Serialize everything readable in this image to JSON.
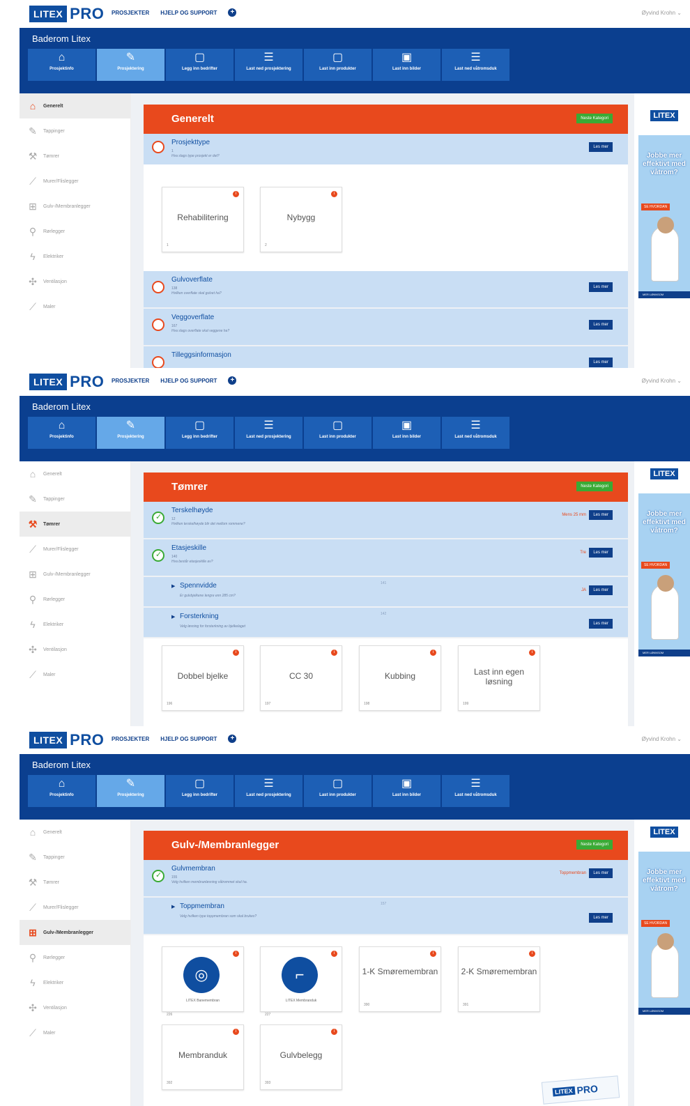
{
  "header": {
    "logo_text": "LITEX",
    "logo_pro": "PRO",
    "nav": [
      "PROSJEKTER",
      "HJELP OG SUPPORT"
    ],
    "user": "Øyvind Krohn ⌄",
    "project_title": "Baderom Litex"
  },
  "steps": [
    {
      "label": "Prosjektinfo",
      "icon": "home-icon"
    },
    {
      "label": "Prosjektering",
      "icon": "clipboard-edit-icon"
    },
    {
      "label": "Legg inn bedrifter",
      "icon": "clipboard-search-icon"
    },
    {
      "label": "Last ned prosjektering",
      "icon": "clipboard-list-icon"
    },
    {
      "label": "Last inn produkter",
      "icon": "clipboard-search-icon"
    },
    {
      "label": "Last inn bilder",
      "icon": "image-icon"
    },
    {
      "label": "Last ned våtromsduk",
      "icon": "clipboard-list-icon"
    }
  ],
  "sidebar": [
    "Generelt",
    "Tappinger",
    "Tømrer",
    "Murer/Flislegger",
    "Gulv-/Membranlegger",
    "Rørlegger",
    "Elektriker",
    "Ventilasjon",
    "Maler"
  ],
  "ad": {
    "logo": "LITEX",
    "text": "Jobbe mer effektivt med våtrom?",
    "button": "SE HVORDAN",
    "footer": "MER LØNNSOM"
  },
  "sticker": {
    "logo": "LITEX",
    "pro": "PRO"
  },
  "panel1": {
    "category": "Generelt",
    "next": "Neste Kategori",
    "q1": {
      "title": "Prosjekttype",
      "id": "1",
      "desc": "Hva slags type prosjekt er det?",
      "les": "Les mer"
    },
    "cards": [
      {
        "label": "Rehabilitering",
        "num": "1"
      },
      {
        "label": "Nybygg",
        "num": "2"
      }
    ],
    "q2": {
      "title": "Gulvoverflate",
      "id": "138",
      "desc": "Hvilken overflate skal gulvet ha?",
      "les": "Les mer"
    },
    "q3": {
      "title": "Veggoverflate",
      "id": "167",
      "desc": "Hva slags overflate skal veggene ha?",
      "les": "Les mer"
    },
    "q4": {
      "title": "Tilleggsinformasjon",
      "les": "Les mer"
    }
  },
  "panel2": {
    "category": "Tømrer",
    "next": "Neste Kategori",
    "q1": {
      "title": "Terskelhøyde",
      "id": "12",
      "desc": "Hvilken terskelhøyde blir det mellom rommene?",
      "answer": "Mens 25 mm",
      "les": "Les mer"
    },
    "q2": {
      "title": "Etasjeskille",
      "id": "140",
      "desc": "Hva består etasjeskille av?",
      "answer": "Tre",
      "les": "Les mer"
    },
    "q3": {
      "title": "Spennvidde",
      "num": "141",
      "desc": "Er gulvbjelkene lengre enn 285 cm?",
      "answer": "JA",
      "les": "Les mer"
    },
    "q4": {
      "title": "Forsterkning",
      "num": "142",
      "desc": "Velg løsning for forsterkning av bjelkelaget",
      "les": "Les mer"
    },
    "cards": [
      {
        "label": "Dobbel bjelke",
        "num": "196"
      },
      {
        "label": "CC 30",
        "num": "197"
      },
      {
        "label": "Kubbing",
        "num": "198"
      },
      {
        "label": "Last inn egen løsning",
        "num": "199"
      }
    ]
  },
  "panel3": {
    "category": "Gulv-/Membranlegger",
    "next": "Neste Kategori",
    "q1": {
      "title": "Gulvmembran",
      "id": "155",
      "desc": "Velg hvilken membranløsning våtrommet skal ha.",
      "answer": "Toppmembran",
      "les": "Les mer"
    },
    "q2": {
      "title": "Toppmembran",
      "num": "157",
      "desc": "Velg hvilken type toppmembran som skal brukes?",
      "les": "Les mer"
    },
    "cards": [
      {
        "label": "LITEX Banemembran",
        "num": "226"
      },
      {
        "label": "LITEX Membranduk",
        "num": "227"
      },
      {
        "label": "1-K Smøremembran",
        "num": "390"
      },
      {
        "label": "2-K Smøremembran",
        "num": "391"
      },
      {
        "label": "Membranduk",
        "num": "392"
      },
      {
        "label": "Gulvbelegg",
        "num": "393"
      }
    ]
  }
}
